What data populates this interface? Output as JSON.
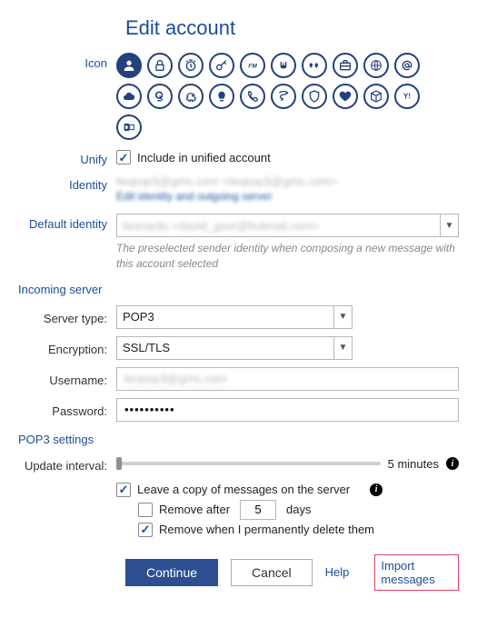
{
  "title": "Edit account",
  "labels": {
    "icon": "Icon",
    "unify": "Unify",
    "identity": "Identity",
    "default_identity": "Default identity",
    "server_type": "Server type:",
    "encryption": "Encryption:",
    "username": "Username:",
    "password": "Password:",
    "update_interval": "Update interval:"
  },
  "sections": {
    "incoming": "Incoming server",
    "pop3": "POP3 settings"
  },
  "identity_line1": "leopop3@gms.com <leopop3@gms.com>",
  "identity_line2": "Edit identity and outgoing server",
  "default_identity": {
    "value": "leonardo <david_gsor@hotmail.com>",
    "help": "The preselected sender identity when composing a new message with this account selected"
  },
  "server": {
    "type": "POP3",
    "encryption": "SSL/TLS",
    "username": "leopop3@gms.com",
    "password": "••••••••••"
  },
  "pop3": {
    "interval_label": "5 minutes",
    "leave_copy": "Leave a copy of messages on the server",
    "remove_after_pre": "Remove after",
    "remove_after_days": "5",
    "remove_after_post": "days",
    "remove_delete": "Remove when I permanently delete them"
  },
  "unify_label": "Include in unified account",
  "buttons": {
    "continue": "Continue",
    "cancel": "Cancel",
    "help": "Help",
    "import": "Import messages"
  },
  "icons": [
    "person",
    "lock",
    "clock",
    "key",
    "fm",
    "mastodon",
    "quote",
    "briefcase",
    "globe",
    "at",
    "cloud",
    "google",
    "piggy",
    "bulb",
    "phone",
    "tornado",
    "shield",
    "heart",
    "cube",
    "yahoo",
    "outlook"
  ]
}
